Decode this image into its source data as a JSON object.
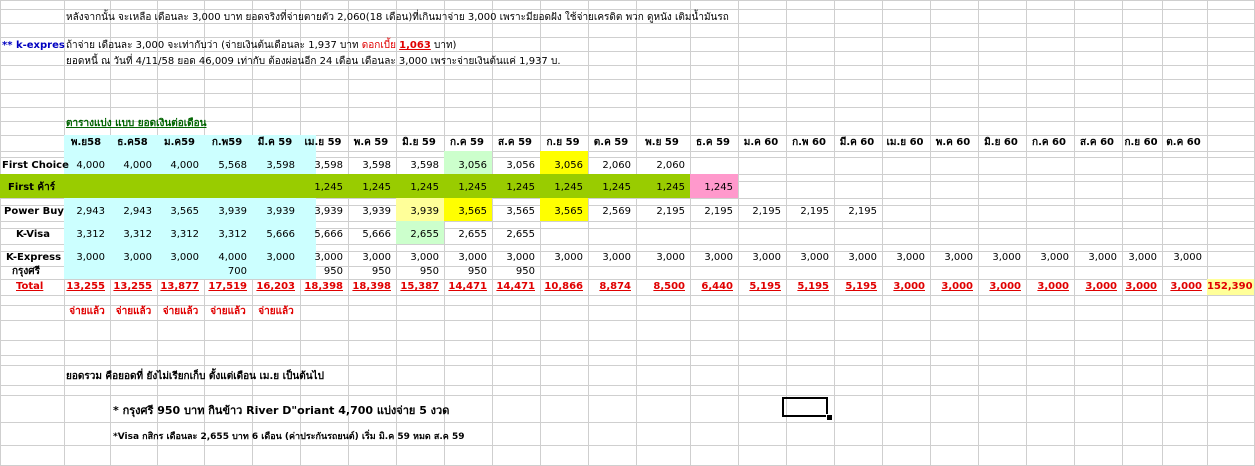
{
  "notes": {
    "line1": "หลังจากนั้น จะเหลือ เดือนละ 3,000 บาท ยอดจริงที่จ่ายตายตัว 2,060(18 เดือน)ที่เกินมาจ่าย 3,000 เพราะมียอดฝัง ใช้จ่ายเครดิต พวก ดูหนัง เติมน้ำมันรถ",
    "kexpress_tag": "** k-expres",
    "line2_pre": "ถ้าจ่าย เดือนละ 3,000 จะเท่ากับว่า (จ่ายเงินต้นเดือนละ 1,937 บาท",
    "line2_interest_label": "ดอกเบี้ย",
    "line2_interest_value": "1,063",
    "line2_post": "บาท)",
    "line3": "ยอดหนี้ ณ วันที่ 4/11/58 ยอด 46,009 เท่ากับ ต้องผ่อนอีก 24 เดือน เดือนละ 3,000 เพราะจ่ายเงินต้นแค่ 1,937 บ."
  },
  "table_title": "ตารางแบ่ง  แบบ ยอดเงินต่อเดือน",
  "months": [
    "พ.ย58",
    "ธ.ค58",
    "ม.ค59",
    "ก.พ59",
    "มี.ค 59",
    "เม.ย 59",
    "พ.ค 59",
    "มิ.ย 59",
    "ก.ค 59",
    "ส.ค 59",
    "ก.ย 59",
    "ต.ค 59",
    "พ.ย 59",
    "ธ.ค 59",
    "ม.ค 60",
    "ก.พ 60",
    "มี.ค 60",
    "เม.ย 60",
    "พ.ค 60",
    "มิ.ย 60",
    "ก.ค 60",
    "ส.ค 60",
    "ก.ย 60",
    "ต.ค 60"
  ],
  "rows": [
    {
      "label": "First Choice",
      "values": [
        "4,000",
        "4,000",
        "4,000",
        "5,568",
        "3,598",
        "3,598",
        "3,598",
        "3,598",
        "3,056",
        "3,056",
        "3,056",
        "2,060",
        "2,060",
        "",
        "",
        "",
        "",
        "",
        "",
        "",
        "",
        "",
        "",
        ""
      ]
    },
    {
      "label": "First ค้าร์",
      "values": [
        "",
        "",
        "",
        "",
        "",
        "1,245",
        "1,245",
        "1,245",
        "1,245",
        "1,245",
        "1,245",
        "1,245",
        "1,245",
        "1,245",
        "",
        "",
        "",
        "",
        "",
        "",
        "",
        "",
        "",
        ""
      ]
    },
    {
      "label": "Power Buy",
      "values": [
        "2,943",
        "2,943",
        "3,565",
        "3,939",
        "3,939",
        "3,939",
        "3,939",
        "3,939",
        "3,565",
        "3,565",
        "3,565",
        "2,569",
        "2,195",
        "2,195",
        "2,195",
        "2,195",
        "2,195",
        "",
        "",
        "",
        "",
        "",
        "",
        ""
      ]
    },
    {
      "label": "K-Visa",
      "values": [
        "3,312",
        "3,312",
        "3,312",
        "3,312",
        "5,666",
        "5,666",
        "5,666",
        "2,655",
        "2,655",
        "2,655",
        "",
        "",
        "",
        "",
        "",
        "",
        "",
        "",
        "",
        "",
        "",
        "",
        "",
        ""
      ]
    },
    {
      "label": "K-Express",
      "values": [
        "3,000",
        "3,000",
        "3,000",
        "4,000",
        "3,000",
        "3,000",
        "3,000",
        "3,000",
        "3,000",
        "3,000",
        "3,000",
        "3,000",
        "3,000",
        "3,000",
        "3,000",
        "3,000",
        "3,000",
        "3,000",
        "3,000",
        "3,000",
        "3,000",
        "3,000",
        "3,000",
        "3,000"
      ]
    },
    {
      "label": "กรุงศรี",
      "values": [
        "",
        "",
        "",
        "700",
        "",
        "950",
        "950",
        "950",
        "950",
        "950",
        "",
        "",
        "",
        "",
        "",
        "",
        "",
        "",
        "",
        "",
        "",
        "",
        "",
        ""
      ]
    }
  ],
  "total": {
    "label": "Total",
    "values": [
      "13,255",
      "13,255",
      "13,877",
      "17,519",
      "16,203",
      "18,398",
      "18,398",
      "15,387",
      "14,471",
      "14,471",
      "10,866",
      "8,874",
      "8,500",
      "6,440",
      "5,195",
      "5,195",
      "5,195",
      "3,000",
      "3,000",
      "3,000",
      "3,000",
      "3,000",
      "3,000",
      "3,000"
    ],
    "grand": "152,390"
  },
  "paid_label": "จ่ายแล้ว",
  "paid_count": 5,
  "footer": {
    "line1": "ยอดรวม คือยอดที่ ยังไม่เรียกเก็บ ตั้งแต่เดือน เม.ย เป็นต้นไป",
    "line2": "* กรุงศรี 950 บาท กินข้าว River D\"oriant 4,700 แบ่งจ่าย 5 งวด",
    "line3": "*Visa กสิกร เดือนละ 2,655 บาท 6 เดือน (ค่าประกันรถยนต์) เริ่ม มิ.ค 59 หมด ส.ค 59"
  },
  "colors": {
    "cyan": "#ccffff",
    "green": "#99cc00",
    "yellow": "#ffff00",
    "lightyellow": "#ffff99",
    "lightgreen": "#ccffcc",
    "pink": "#ff99cc",
    "totalred": "#e00000",
    "grand_bg": "#ffff99"
  }
}
